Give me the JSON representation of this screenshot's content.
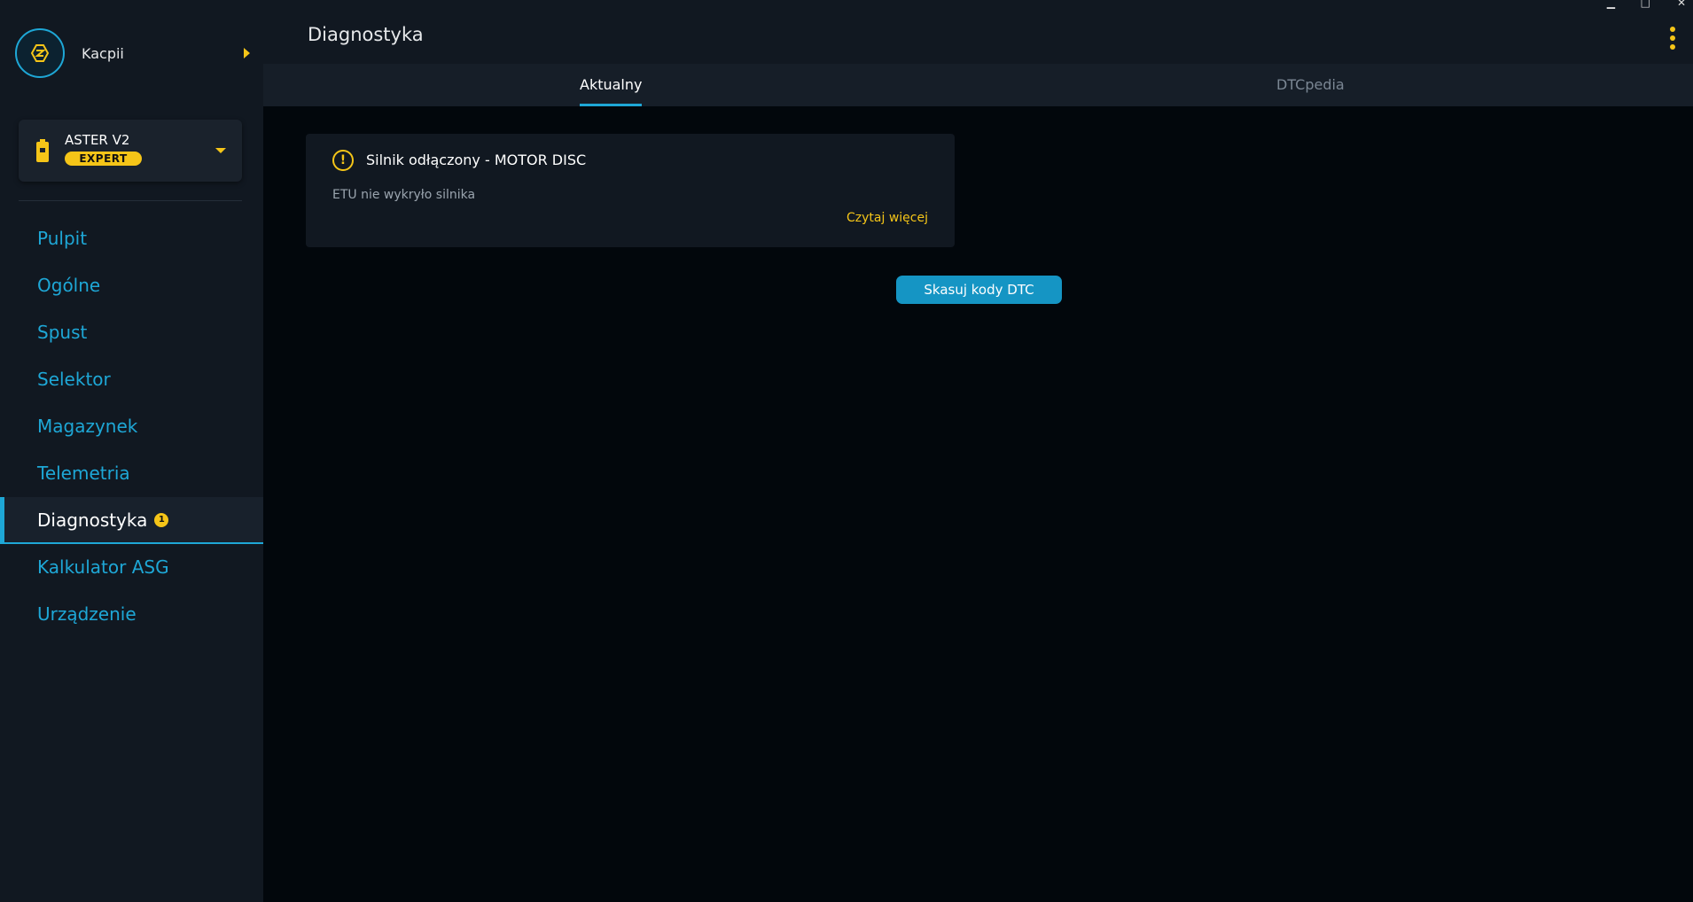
{
  "user": {
    "name": "Kacpii",
    "avatar_icon": "grenade-logo-icon",
    "expand_icon": "caret-right-icon"
  },
  "device": {
    "name": "ASTER V2",
    "badge": "EXPERT",
    "icon": "battery-icon",
    "dropdown_icon": "caret-down-icon"
  },
  "sidebar": {
    "items": [
      {
        "label": "Pulpit"
      },
      {
        "label": "Ogólne"
      },
      {
        "label": "Spust"
      },
      {
        "label": "Selektor"
      },
      {
        "label": "Magazynek"
      },
      {
        "label": "Telemetria"
      },
      {
        "label": "Diagnostyka",
        "active": true,
        "badge": "1"
      },
      {
        "label": "Kalkulator ASG"
      },
      {
        "label": "Urządzenie"
      }
    ]
  },
  "header": {
    "title": "Diagnostyka",
    "menu_icon": "kebab-menu-icon"
  },
  "tabs": [
    {
      "label": "Aktualny",
      "active": true
    },
    {
      "label": "DTCpedia"
    }
  ],
  "dtc_card": {
    "icon": "warning-icon",
    "title": "Silnik odłączony - MOTOR DISC",
    "description": "ETU nie wykryło silnika",
    "link": "Czytaj więcej"
  },
  "actions": {
    "clear_label": "Skasuj kody DTC"
  },
  "colors": {
    "accent": "#1ea7d6",
    "warning": "#f5c518",
    "background": "#02070c",
    "panel": "#111821"
  }
}
